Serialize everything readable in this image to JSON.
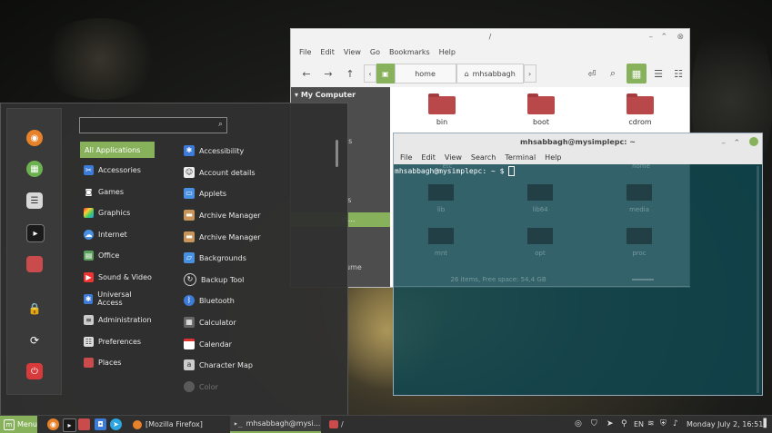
{
  "colors": {
    "accent": "#87b15a",
    "menu_bg": "#303030",
    "panel_bg": "#2f2f2f",
    "folder": "#b8484a"
  },
  "file_manager": {
    "title": "/",
    "menu": [
      "File",
      "Edit",
      "View",
      "Go",
      "Bookmarks",
      "Help"
    ],
    "breadcrumbs": [
      "home",
      "mhsabbagh"
    ],
    "sidebar": {
      "header": "My Computer",
      "partial_items": [
        "ts",
        "ls",
        "m...",
        "ume"
      ]
    },
    "folders": [
      "bin",
      "boot",
      "cdrom"
    ],
    "status": "26 items, Free space: 54,4 GB"
  },
  "terminal": {
    "title": "mhsabbagh@mysimplepc: ~",
    "menu": [
      "File",
      "Edit",
      "View",
      "Search",
      "Terminal",
      "Help"
    ],
    "prompt": "mhsabbagh@mysimplepc: ~ $",
    "ghost_labels": [
      "etc",
      "home",
      "lib",
      "lib64",
      "media",
      "mnt",
      "opt",
      "proc"
    ]
  },
  "menu": {
    "search_placeholder": "",
    "categories": [
      "All Applications",
      "Accessories",
      "Games",
      "Graphics",
      "Internet",
      "Office",
      "Sound & Video",
      "Universal Access",
      "Administration",
      "Preferences",
      "Places"
    ],
    "apps": [
      "Accessibility",
      "Account details",
      "Applets",
      "Archive Manager",
      "Archive Manager",
      "Backgrounds",
      "Backup Tool",
      "Bluetooth",
      "Calculator",
      "Calendar",
      "Character Map",
      "Color"
    ],
    "favorites": [
      "firefox-icon",
      "software-manager-icon",
      "settings-icon",
      "terminal-icon",
      "files-icon",
      "lock-icon",
      "logout-icon",
      "power-icon"
    ]
  },
  "panel": {
    "menu_label": "Menu",
    "tasks": [
      "[Mozilla Firefox]",
      "mhsabbagh@mysi...",
      "/"
    ],
    "lang": "EN",
    "clock": "Monday July 2, 16:51"
  }
}
